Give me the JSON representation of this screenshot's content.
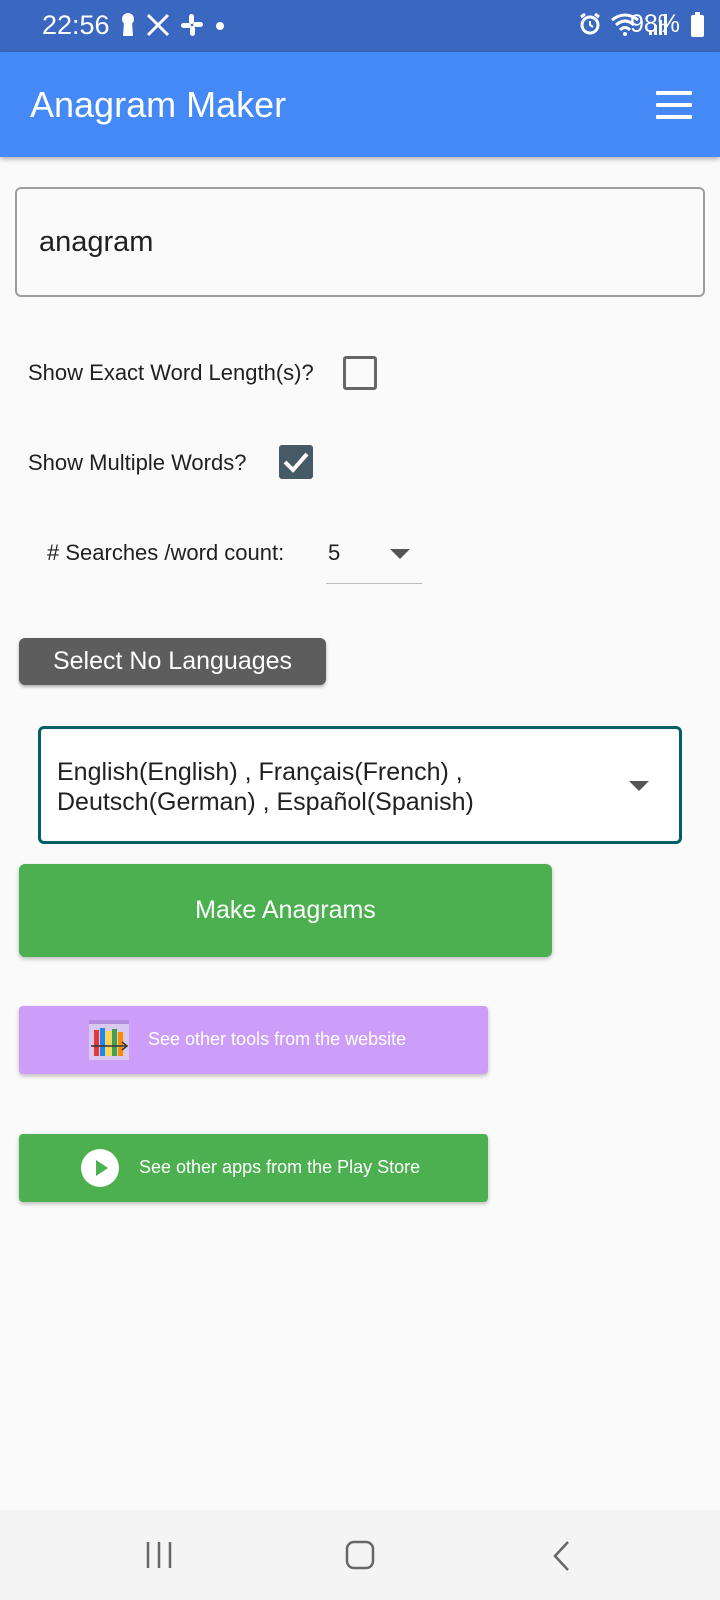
{
  "status_bar": {
    "time": "22:56",
    "battery": "98%",
    "left_icons": [
      "keyhole-icon",
      "x-icon",
      "slack-icon",
      "dot-icon"
    ],
    "right_icons": [
      "alarm-icon",
      "wifi-icon",
      "signal-icon",
      "battery-icon"
    ]
  },
  "app_bar": {
    "title": "Anagram Maker",
    "menu_icon": "hamburger-menu-icon",
    "color": "#4489f5"
  },
  "input": {
    "value": "anagram"
  },
  "options": {
    "exact_length_label": "Show Exact Word Length(s)?",
    "exact_length_checked": false,
    "multiple_words_label": "Show Multiple Words?",
    "multiple_words_checked": true,
    "searches_label": "# Searches /word count:",
    "searches_value": "5"
  },
  "buttons": {
    "select_no_languages": "Select No Languages",
    "make_anagrams": "Make Anagrams",
    "website_tools": "See other tools from the website",
    "play_store": "See other apps from the Play Store"
  },
  "languages": {
    "selected": "English(English) , Français(French) , Deutsch(German) , Español(Spanish)"
  },
  "nav_bar": {
    "icons": [
      "recent-apps-icon",
      "home-icon",
      "back-icon"
    ]
  },
  "colors": {
    "status_bar": "#3a67bf",
    "primary": "#4489f5",
    "green": "#4caf50",
    "purple": "#cc9ef9",
    "teal_border": "#006064",
    "dark_button": "#5d5d5d"
  }
}
